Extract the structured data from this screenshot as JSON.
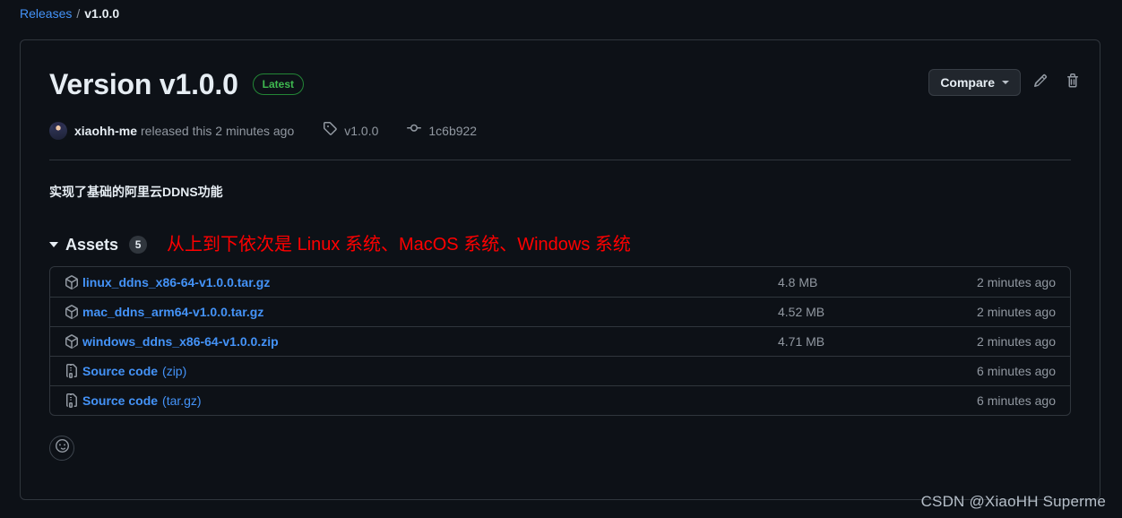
{
  "breadcrumb": {
    "root_label": "Releases",
    "separator": "/",
    "current_label": "v1.0.0"
  },
  "release": {
    "title": "Version v1.0.0",
    "latest_badge": "Latest",
    "author": "xiaohh-me",
    "released_text": "released this 2 minutes ago",
    "tag_name": "v1.0.0",
    "commit_sha": "1c6b922",
    "body": "实现了基础的阿里云DDNS功能"
  },
  "header_actions": {
    "compare_label": "Compare",
    "edit_icon": "pencil-icon",
    "delete_icon": "trash-icon",
    "dropdown_icon": "chevron-down-icon"
  },
  "assets": {
    "title": "Assets",
    "count": "5",
    "annotation": "从上到下依次是 Linux 系统、MacOS 系统、Windows 系统",
    "rows": [
      {
        "icon": "package-icon",
        "name": "linux_ddns_x86-64-v1.0.0.tar.gz",
        "suffix": "",
        "size": "4.8 MB",
        "time": "2 minutes ago"
      },
      {
        "icon": "package-icon",
        "name": "mac_ddns_arm64-v1.0.0.tar.gz",
        "suffix": "",
        "size": "4.52 MB",
        "time": "2 minutes ago"
      },
      {
        "icon": "package-icon",
        "name": "windows_ddns_x86-64-v1.0.0.zip",
        "suffix": "",
        "size": "4.71 MB",
        "time": "2 minutes ago"
      },
      {
        "icon": "file-zip-icon",
        "name": "Source code",
        "suffix": "(zip)",
        "size": "",
        "time": "6 minutes ago"
      },
      {
        "icon": "file-zip-icon",
        "name": "Source code",
        "suffix": "(tar.gz)",
        "size": "",
        "time": "6 minutes ago"
      }
    ]
  },
  "reaction": {
    "icon": "smiley-icon"
  },
  "watermark": {
    "text": "CSDN @XiaoHH Superme"
  },
  "colors": {
    "page_bg": "#0d1117",
    "border": "#30363d",
    "link": "#4493f8",
    "muted": "#9198a1",
    "badge_green": "#3fb950",
    "annotation_red": "#ff0000"
  }
}
